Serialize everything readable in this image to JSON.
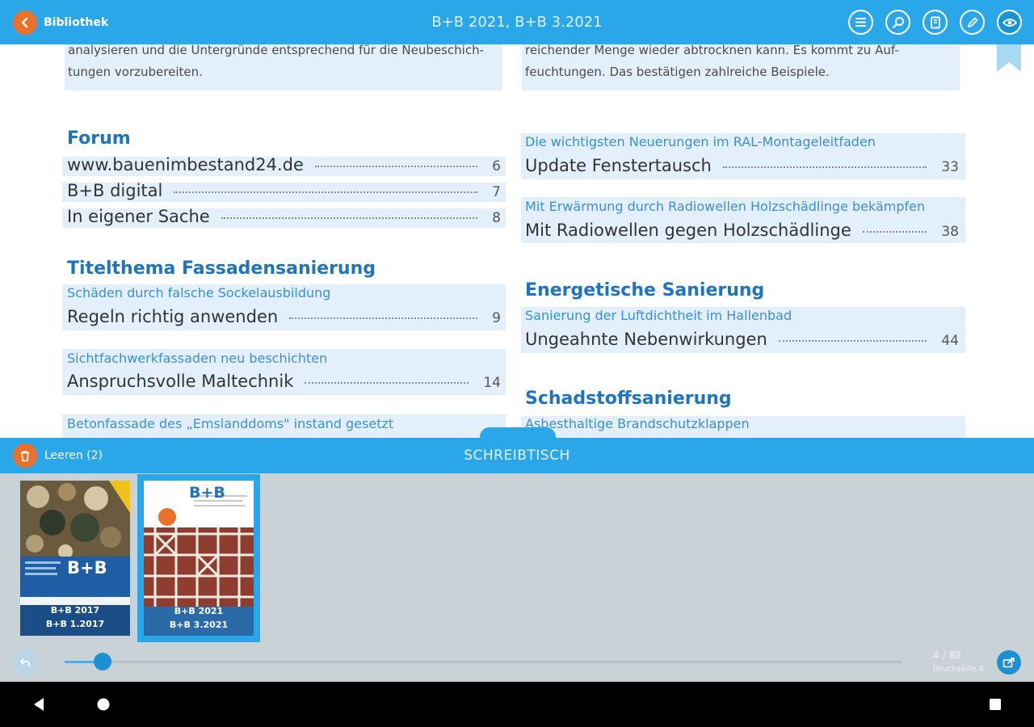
{
  "topbar": {
    "back_label": "Bibliothek",
    "doc_title": "B+B 2021, B+B  3.2021",
    "icons": [
      "toc-icon",
      "search-icon",
      "pages-icon",
      "pen-icon",
      "eye-icon"
    ]
  },
  "page": {
    "left_intro": [
      "analysieren und die Untergründe entsprechend für die Neubeschich-",
      "tungen vorzubereiten."
    ],
    "right_intro": [
      "reichender Menge wieder abtrocknen kann. Es kommt zu Auf-",
      "feuchtungen. Das bestätigen zahlreiche Beispiele."
    ],
    "left_column": {
      "forum_heading": "Forum",
      "forum_entries": [
        {
          "title": "www.bauenimbestand24.de",
          "page": "6"
        },
        {
          "title": "B+B digital",
          "page": "7"
        },
        {
          "title": "In eigener Sache",
          "page": "8"
        }
      ],
      "title_heading": "Titelthema Fassadensanierung",
      "title_articles": [
        {
          "subtitle": "Schäden durch falsche Sockelausbildung",
          "title": "Regeln richtig anwenden",
          "page": "9"
        },
        {
          "subtitle": "Sichtfachwerkfassaden neu beschichten",
          "title": "Anspruchsvolle Maltechnik",
          "page": "14"
        }
      ],
      "cut_subtitle": "Betonfassade des „Emslanddoms\" instand gesetzt"
    },
    "right_column": {
      "articles_top": [
        {
          "subtitle": "Die wichtigsten Neuerungen im RAL-Montageleitfaden",
          "title": "Update Fenstertausch",
          "page": "33"
        },
        {
          "subtitle": "Mit Erwärmung durch Radiowellen Holzschädlinge bekämpfen",
          "title": "Mit Radiowellen gegen Holzschädlinge",
          "page": "38"
        }
      ],
      "energy_heading": "Energetische Sanierung",
      "energy_article": {
        "subtitle": "Sanierung der Luftdichtheit im Hallenbad",
        "title": "Ungeahnte Nebenwirkungen",
        "page": "44"
      },
      "pollutant_heading": "Schadstoffsanierung",
      "cut_subtitle": "Asbesthaltige Brandschutzklappen"
    }
  },
  "desk": {
    "clear_label": "Leeren (2)",
    "title": "SCHREIBTISCH",
    "covers": [
      {
        "line1": "B+B 2017",
        "line2": "B+B  1.2017",
        "selected": false
      },
      {
        "line1": "B+B 2021",
        "line2": "B+B  3.2021",
        "selected": true
      }
    ],
    "cover_logo": "B+B",
    "page_count": "4 / 88",
    "print_page": "Druckseite 4",
    "slider_fraction": 0.045
  },
  "colors": {
    "accent": "#2aa7e8",
    "orange": "#e9712a",
    "heading": "#1e74bf",
    "subtitle": "#3a8fd6",
    "entry_bg": "#e3f0fb"
  }
}
